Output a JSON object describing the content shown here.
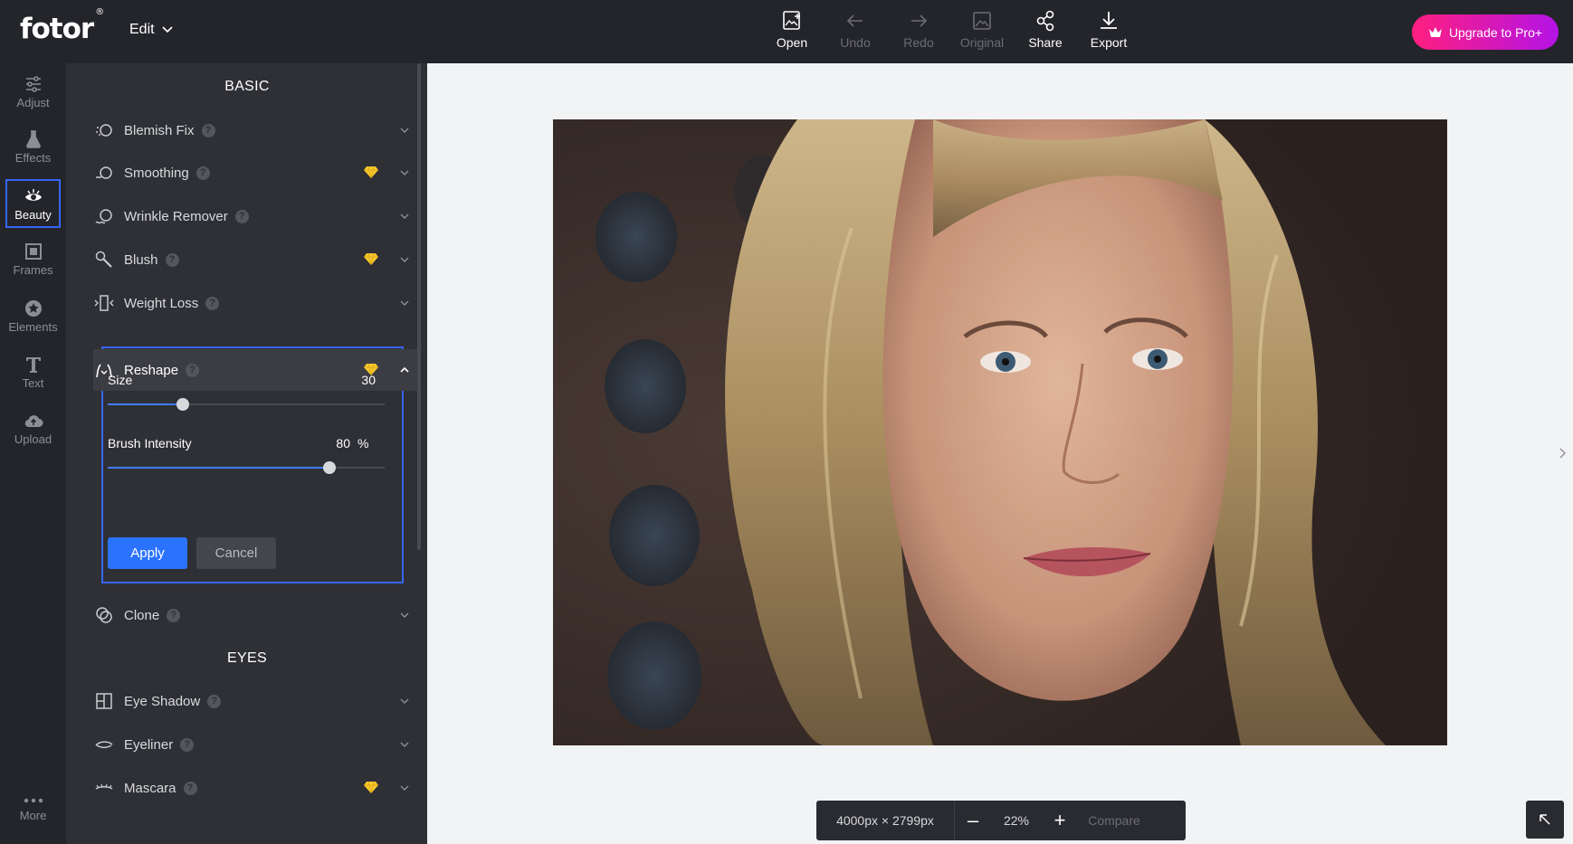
{
  "brand": {
    "logo": "fotor",
    "reg": "®"
  },
  "header": {
    "edit_menu": "Edit",
    "tools": [
      {
        "label": "Open",
        "icon": "open-image-icon",
        "enabled": true
      },
      {
        "label": "Undo",
        "icon": "undo-icon",
        "enabled": false
      },
      {
        "label": "Redo",
        "icon": "redo-icon",
        "enabled": false
      },
      {
        "label": "Original",
        "icon": "original-image-icon",
        "enabled": false
      },
      {
        "label": "Share",
        "icon": "share-icon",
        "enabled": true
      },
      {
        "label": "Export",
        "icon": "export-icon",
        "enabled": true
      }
    ],
    "upgrade": "Upgrade to Pro+"
  },
  "rail": {
    "items": [
      {
        "label": "Adjust",
        "icon": "sliders-icon"
      },
      {
        "label": "Effects",
        "icon": "flask-icon"
      },
      {
        "label": "Beauty",
        "icon": "eye-icon",
        "active": true
      },
      {
        "label": "Frames",
        "icon": "frame-icon"
      },
      {
        "label": "Elements",
        "icon": "star-icon"
      },
      {
        "label": "Text",
        "icon": "text-icon"
      },
      {
        "label": "Upload",
        "icon": "cloud-upload-icon"
      }
    ],
    "more": "More"
  },
  "panel": {
    "basic_title": "BASIC",
    "eyes_title": "EYES",
    "items": [
      {
        "label": "Blemish Fix",
        "pro": false
      },
      {
        "label": "Smoothing",
        "pro": true
      },
      {
        "label": "Wrinkle Remover",
        "pro": false
      },
      {
        "label": "Blush",
        "pro": true
      },
      {
        "label": "Weight Loss",
        "pro": false
      },
      {
        "label": "Reshape",
        "pro": true,
        "expanded": true
      },
      {
        "label": "Clone",
        "pro": false
      },
      {
        "label": "Eye Shadow",
        "pro": false
      },
      {
        "label": "Eyeliner",
        "pro": false
      },
      {
        "label": "Mascara",
        "pro": true
      }
    ],
    "reshape": {
      "size_label": "Size",
      "size_value": "30",
      "size_fraction": 0.27,
      "intensity_label": "Brush Intensity",
      "intensity_value": "80",
      "intensity_unit": "%",
      "intensity_fraction": 0.8,
      "apply": "Apply",
      "cancel": "Cancel"
    },
    "help_glyph": "?"
  },
  "zoom": {
    "dimensions": "4000px × 2799px",
    "minus": "–",
    "percent": "22%",
    "plus": "+",
    "compare": "Compare"
  },
  "colors": {
    "accent": "#2b73ff",
    "selection": "#3766f4",
    "pro_gem": "#f7c82e",
    "upgrade_start": "#ff1f7f",
    "upgrade_end": "#b413e6"
  }
}
